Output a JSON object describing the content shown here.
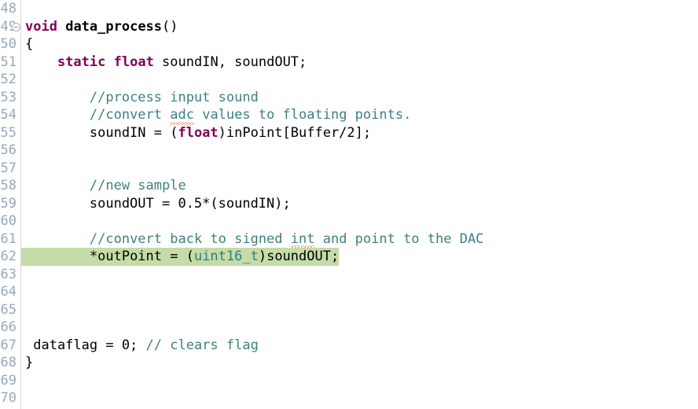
{
  "editor": {
    "language": "c",
    "colors": {
      "background": "#ffffff",
      "keyword": "#7f0055",
      "comment": "#3f7f7f",
      "type": "#2a7f7f",
      "line_number": "#9aa7b8",
      "highlight": "#c5dba8",
      "spellcheck_squiggle": "#e8622a",
      "gutter_rule": "#d8d8d8"
    },
    "gutter": {
      "line_numbers": [
        48,
        49,
        50,
        51,
        52,
        53,
        54,
        55,
        56,
        57,
        58,
        59,
        60,
        61,
        62,
        63,
        64,
        65,
        66,
        67,
        68,
        69,
        70
      ],
      "fold_marker_line": 49,
      "fold_marker_icon": "collapse-minus-icon"
    },
    "highlighted_line": 62,
    "lines": [
      {
        "number": 48,
        "tokens": []
      },
      {
        "number": 49,
        "tokens": [
          {
            "t": "void",
            "c": "kw"
          },
          {
            "t": " ",
            "c": "plain"
          },
          {
            "t": "data_process",
            "c": "fn"
          },
          {
            "t": "()",
            "c": "plain"
          }
        ]
      },
      {
        "number": 50,
        "tokens": [
          {
            "t": "{",
            "c": "plain"
          }
        ]
      },
      {
        "number": 51,
        "tokens": [
          {
            "t": "    ",
            "c": "plain"
          },
          {
            "t": "static",
            "c": "kw"
          },
          {
            "t": " ",
            "c": "plain"
          },
          {
            "t": "float",
            "c": "kw"
          },
          {
            "t": " soundIN, soundOUT;",
            "c": "plain"
          }
        ]
      },
      {
        "number": 52,
        "tokens": []
      },
      {
        "number": 53,
        "tokens": [
          {
            "t": "        ",
            "c": "plain"
          },
          {
            "t": "//process input sound",
            "c": "cmt"
          }
        ]
      },
      {
        "number": 54,
        "tokens": [
          {
            "t": "        ",
            "c": "plain"
          },
          {
            "t": "//convert ",
            "c": "cmt"
          },
          {
            "t": "adc",
            "c": "cmt",
            "squiggle": true
          },
          {
            "t": " values to floating points.",
            "c": "cmt"
          }
        ]
      },
      {
        "number": 55,
        "tokens": [
          {
            "t": "        soundIN = (",
            "c": "plain"
          },
          {
            "t": "float",
            "c": "kw"
          },
          {
            "t": ")inPoint[Buffer/2];",
            "c": "plain"
          }
        ]
      },
      {
        "number": 56,
        "tokens": []
      },
      {
        "number": 57,
        "tokens": []
      },
      {
        "number": 58,
        "tokens": [
          {
            "t": "        ",
            "c": "plain"
          },
          {
            "t": "//new sample",
            "c": "cmt"
          }
        ]
      },
      {
        "number": 59,
        "tokens": [
          {
            "t": "        soundOUT = 0.5*(soundIN);",
            "c": "plain"
          }
        ]
      },
      {
        "number": 60,
        "tokens": []
      },
      {
        "number": 61,
        "tokens": [
          {
            "t": "        ",
            "c": "plain"
          },
          {
            "t": "//convert back to signed ",
            "c": "cmt"
          },
          {
            "t": "int",
            "c": "cmt",
            "squiggle": true
          },
          {
            "t": " and point to the DAC",
            "c": "cmt"
          }
        ]
      },
      {
        "number": 62,
        "highlighted": true,
        "tokens": [
          {
            "t": "        ",
            "c": "plain"
          },
          {
            "t": "*outPoint = (",
            "c": "plain"
          },
          {
            "t": "uint16_t",
            "c": "type"
          },
          {
            "t": ")soundOUT;",
            "c": "plain"
          }
        ]
      },
      {
        "number": 63,
        "tokens": []
      },
      {
        "number": 64,
        "tokens": []
      },
      {
        "number": 65,
        "tokens": []
      },
      {
        "number": 66,
        "tokens": []
      },
      {
        "number": 67,
        "tokens": [
          {
            "t": " dataflag = 0; ",
            "c": "plain"
          },
          {
            "t": "// clears flag",
            "c": "cmt"
          }
        ]
      },
      {
        "number": 68,
        "tokens": [
          {
            "t": "}",
            "c": "plain"
          }
        ]
      },
      {
        "number": 69,
        "tokens": []
      },
      {
        "number": 70,
        "tokens": []
      }
    ]
  }
}
